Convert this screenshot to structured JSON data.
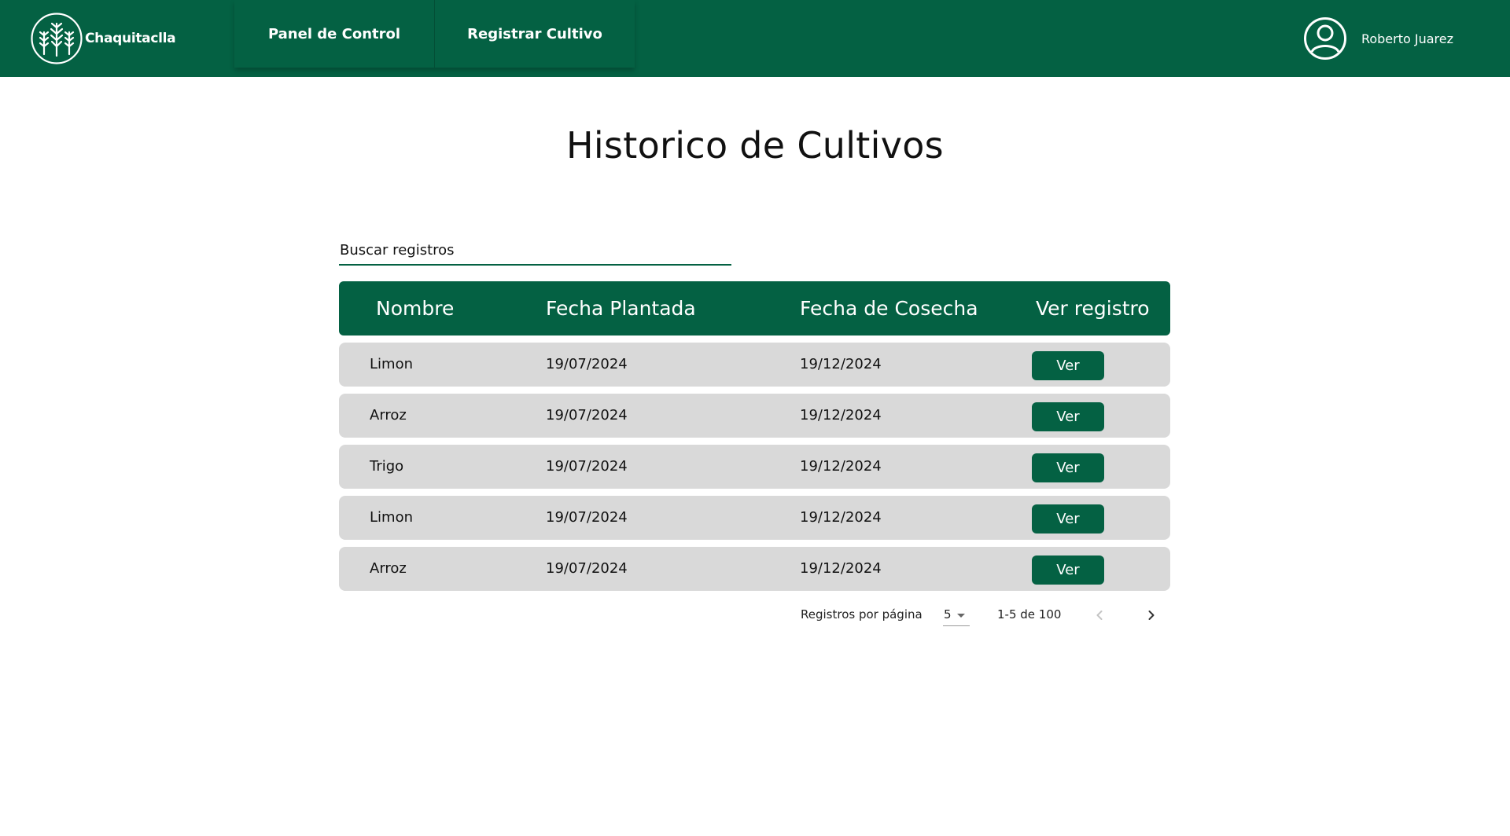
{
  "app": {
    "logo_text": "Chaquitaclla",
    "icon": "wheat-logo-icon"
  },
  "nav": {
    "items": [
      {
        "label": "Panel de Control"
      },
      {
        "label": "Registrar Cultivo"
      }
    ]
  },
  "user": {
    "name": "Roberto Juarez",
    "icon": "user-circle-icon"
  },
  "page": {
    "title": "Historico de Cultivos"
  },
  "search": {
    "placeholder": "Buscar registros",
    "value": ""
  },
  "table": {
    "columns": [
      "Nombre",
      "Fecha Plantada",
      "Fecha de Cosecha",
      "Ver registro"
    ],
    "rows": [
      {
        "nombre": "Limon",
        "plantada": "19/07/2024",
        "cosecha": "19/12/2024",
        "action": "Ver"
      },
      {
        "nombre": "Arroz",
        "plantada": "19/07/2024",
        "cosecha": "19/12/2024",
        "action": "Ver"
      },
      {
        "nombre": "Trigo",
        "plantada": "19/07/2024",
        "cosecha": "19/12/2024",
        "action": "Ver"
      },
      {
        "nombre": "Limon",
        "plantada": "19/07/2024",
        "cosecha": "19/12/2024",
        "action": "Ver"
      },
      {
        "nombre": "Arroz",
        "plantada": "19/07/2024",
        "cosecha": "19/12/2024",
        "action": "Ver"
      }
    ]
  },
  "pagination": {
    "label": "Registros por página",
    "per_page": "5",
    "range": "1-5 de 100",
    "prev_icon": "chevron-left-icon",
    "next_icon": "chevron-right-icon"
  },
  "colors": {
    "brand": "#046143",
    "row_bg": "#d9d9d9",
    "background": "#ffffff"
  }
}
